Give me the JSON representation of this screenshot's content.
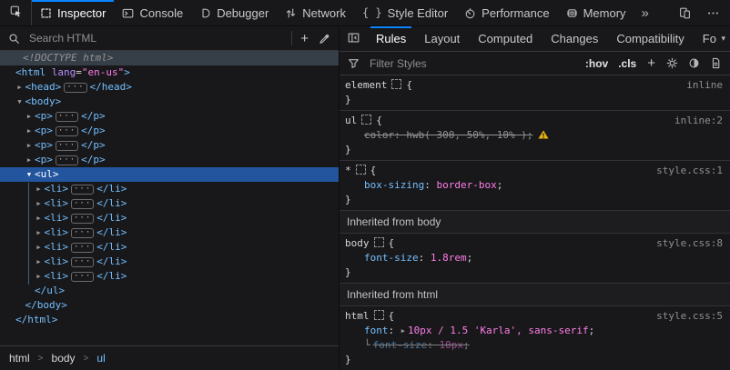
{
  "colors": {
    "accent": "#0a84ff",
    "selection_background": "#23559e",
    "tag": "#75bfff",
    "attribute_name": "#b98eff",
    "attribute_value": "#ff7de9",
    "property_name": "#75bfff",
    "property_value": "#ff7de9",
    "warning": "#e8b410"
  },
  "toolbar": {
    "tabs": [
      {
        "label": "Inspector",
        "icon": "inspector-icon",
        "active": true
      },
      {
        "label": "Console",
        "icon": "console-icon",
        "active": false
      },
      {
        "label": "Debugger",
        "icon": "debugger-icon",
        "active": false
      },
      {
        "label": "Network",
        "icon": "network-icon",
        "active": false
      },
      {
        "label": "Style Editor",
        "icon": "style-editor-icon",
        "active": false
      },
      {
        "label": "Performance",
        "icon": "performance-icon",
        "active": false
      },
      {
        "label": "Memory",
        "icon": "memory-icon",
        "active": false
      }
    ],
    "more_tabs_label": "»",
    "icons": [
      "pick-element-icon",
      "responsive-mode-icon",
      "meatball-menu-icon"
    ]
  },
  "markup": {
    "search_placeholder": "Search HTML",
    "add_node_button": "+",
    "ellipsis_badge": "···",
    "rows": [
      {
        "kind": "doctype",
        "text": "<!DOCTYPE html>",
        "indent": 0,
        "highlighted": true
      },
      {
        "kind": "element",
        "tag": "html",
        "attr": {
          "name": "lang",
          "value": "en-us"
        },
        "indent": 0
      },
      {
        "kind": "collapsed",
        "tag": "head",
        "indent": 1
      },
      {
        "kind": "expanded",
        "tag": "body",
        "indent": 1
      },
      {
        "kind": "collapsed",
        "tag": "p",
        "indent": 2
      },
      {
        "kind": "collapsed",
        "tag": "p",
        "indent": 2
      },
      {
        "kind": "collapsed",
        "tag": "p",
        "indent": 2
      },
      {
        "kind": "collapsed",
        "tag": "p",
        "indent": 2
      },
      {
        "kind": "expanded",
        "tag": "ul",
        "indent": 2,
        "selected": true
      },
      {
        "kind": "collapsed",
        "tag": "li",
        "indent": 3
      },
      {
        "kind": "collapsed",
        "tag": "li",
        "indent": 3
      },
      {
        "kind": "collapsed",
        "tag": "li",
        "indent": 3
      },
      {
        "kind": "collapsed",
        "tag": "li",
        "indent": 3
      },
      {
        "kind": "collapsed",
        "tag": "li",
        "indent": 3
      },
      {
        "kind": "collapsed",
        "tag": "li",
        "indent": 3
      },
      {
        "kind": "collapsed",
        "tag": "li",
        "indent": 3
      },
      {
        "kind": "close",
        "tag": "ul",
        "indent": 2
      },
      {
        "kind": "close",
        "tag": "body",
        "indent": 1
      },
      {
        "kind": "close",
        "tag": "html",
        "indent": 0
      }
    ]
  },
  "breadcrumb": {
    "separator": ">",
    "items": [
      {
        "label": "html",
        "selected": false
      },
      {
        "label": "body",
        "selected": false
      },
      {
        "label": "ul",
        "selected": true
      }
    ]
  },
  "rules_panel": {
    "tabs": [
      {
        "label": "Rules",
        "active": true
      },
      {
        "label": "Layout",
        "active": false
      },
      {
        "label": "Computed",
        "active": false
      },
      {
        "label": "Changes",
        "active": false
      },
      {
        "label": "Compatibility",
        "active": false
      },
      {
        "label": "Fo",
        "active": false
      }
    ],
    "filter_placeholder": "Filter Styles",
    "pseudo_class_button": ":hov",
    "class_button": ".cls",
    "add_rule_button": "+",
    "sections": [
      {
        "type": "rule",
        "selector": "element",
        "source": "inline",
        "declarations": []
      },
      {
        "type": "rule",
        "selector": "ul",
        "source": "inline:2",
        "declarations": [
          {
            "name": "color",
            "value": "hwb( 300, 50%, 10% )",
            "state": "invalid",
            "warning": true
          }
        ]
      },
      {
        "type": "rule",
        "selector": "*",
        "source": "style.css:1",
        "declarations": [
          {
            "name": "box-sizing",
            "value": "border-box",
            "state": "normal"
          }
        ]
      },
      {
        "type": "header",
        "label": "Inherited from body"
      },
      {
        "type": "rule",
        "selector": "body",
        "source": "style.css:8",
        "declarations": [
          {
            "name": "font-size",
            "value": "1.8rem",
            "state": "normal"
          }
        ]
      },
      {
        "type": "header",
        "label": "Inherited from html"
      },
      {
        "type": "rule",
        "selector": "html",
        "source": "style.css:5",
        "declarations": [
          {
            "name": "font",
            "value": "10px / 1.5 'Karla', sans-serif",
            "state": "normal",
            "expandable": true
          },
          {
            "name": "font-size",
            "value": "10px",
            "state": "overridden",
            "connector": true
          }
        ]
      }
    ]
  }
}
